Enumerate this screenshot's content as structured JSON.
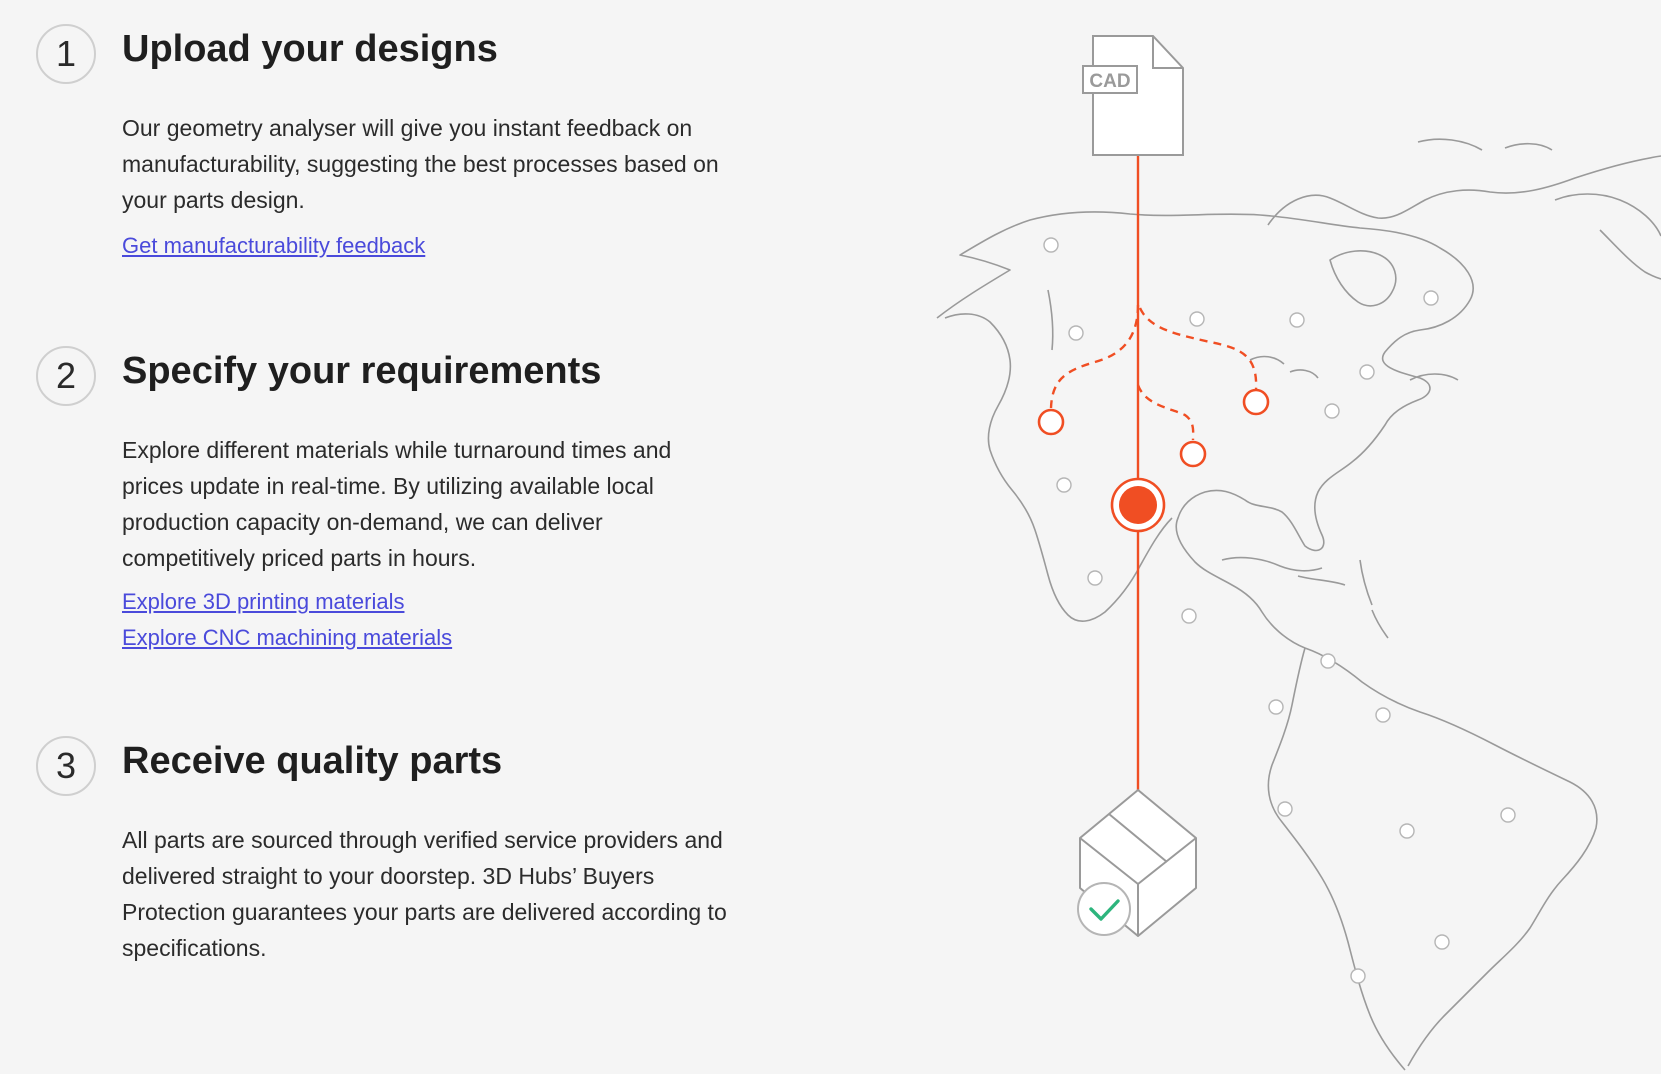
{
  "steps": [
    {
      "number": "1",
      "title": "Upload your designs",
      "description": "Our geometry analyser will give you instant feedback on manufacturability, suggesting the best processes based on your parts design.",
      "links": [
        "Get manufacturability feedback"
      ]
    },
    {
      "number": "2",
      "title": "Specify your requirements",
      "description": "Explore different materials while turnaround times and prices update in real-time. By utilizing available local production capacity on-demand, we can deliver competitively priced parts in hours.",
      "links": [
        "Explore 3D printing materials",
        "Explore CNC machining materials"
      ]
    },
    {
      "number": "3",
      "title": "Receive quality parts",
      "description": "All parts are sourced through verified service providers and delivered straight to your doorstep. 3D Hubs’ Buyers Protection guarantees your parts are delivered according to specifications.",
      "links": []
    }
  ],
  "illustration": {
    "file_label": "CAD",
    "icons": [
      "cad-file-icon",
      "world-map",
      "location-pin-icon",
      "package-box-icon",
      "checkmark-icon"
    ],
    "colors": {
      "accent": "#f04e23",
      "check": "#2db57d",
      "outline": "#9a9a9a",
      "link": "#4a4adb"
    }
  }
}
